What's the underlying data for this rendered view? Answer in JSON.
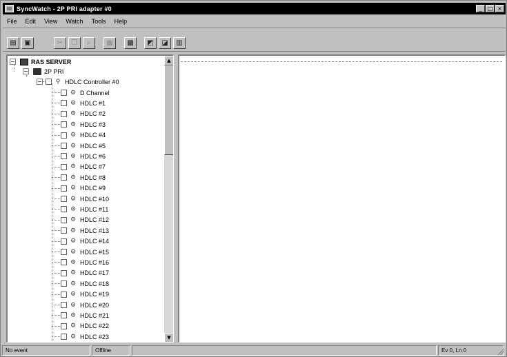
{
  "window": {
    "title": "SyncWatch - 2P PRI adapter #0",
    "controls": [
      "_",
      "□",
      "×"
    ]
  },
  "menu": [
    "File",
    "Edit",
    "View",
    "Watch",
    "Tools",
    "Help"
  ],
  "toolbar": {
    "buttons": [
      {
        "name": "open-icon",
        "glyph": "▤",
        "enabled": true
      },
      {
        "name": "save-icon",
        "glyph": "▣",
        "enabled": true
      },
      {
        "name": "cut-icon",
        "glyph": "✂",
        "enabled": false
      },
      {
        "name": "copy-icon",
        "glyph": "❐",
        "enabled": false
      },
      {
        "name": "find-icon",
        "glyph": "⌕",
        "enabled": false
      },
      {
        "name": "grid-icon",
        "glyph": "▦",
        "enabled": false
      },
      {
        "name": "properties-icon",
        "glyph": "▩",
        "enabled": true
      },
      {
        "name": "start-watch-icon",
        "glyph": "◩",
        "enabled": true
      },
      {
        "name": "stop-watch-icon",
        "glyph": "◪",
        "enabled": true
      },
      {
        "name": "print-icon",
        "glyph": "▥",
        "enabled": true
      }
    ]
  },
  "tree": {
    "root": {
      "label": "RAS SERVER",
      "expander": "−"
    },
    "adapter": {
      "label": "2P PRI",
      "expander": "−"
    },
    "controller": {
      "label": "HDLC Controller #0",
      "expander": "−"
    },
    "channels": [
      "D Channel",
      "HDLC #1",
      "HDLC #2",
      "HDLC #3",
      "HDLC #4",
      "HDLC #5",
      "HDLC #6",
      "HDLC #7",
      "HDLC #8",
      "HDLC #9",
      "HDLC #10",
      "HDLC #11",
      "HDLC #12",
      "HDLC #13",
      "HDLC #14",
      "HDLC #15",
      "HDLC #16",
      "HDLC #17",
      "HDLC #18",
      "HDLC #19",
      "HDLC #20",
      "HDLC #21",
      "HDLC #22",
      "HDLC #23"
    ]
  },
  "statusbar": {
    "event": "No event",
    "state": "Offline",
    "position": "Ev 0, Ln 0"
  }
}
